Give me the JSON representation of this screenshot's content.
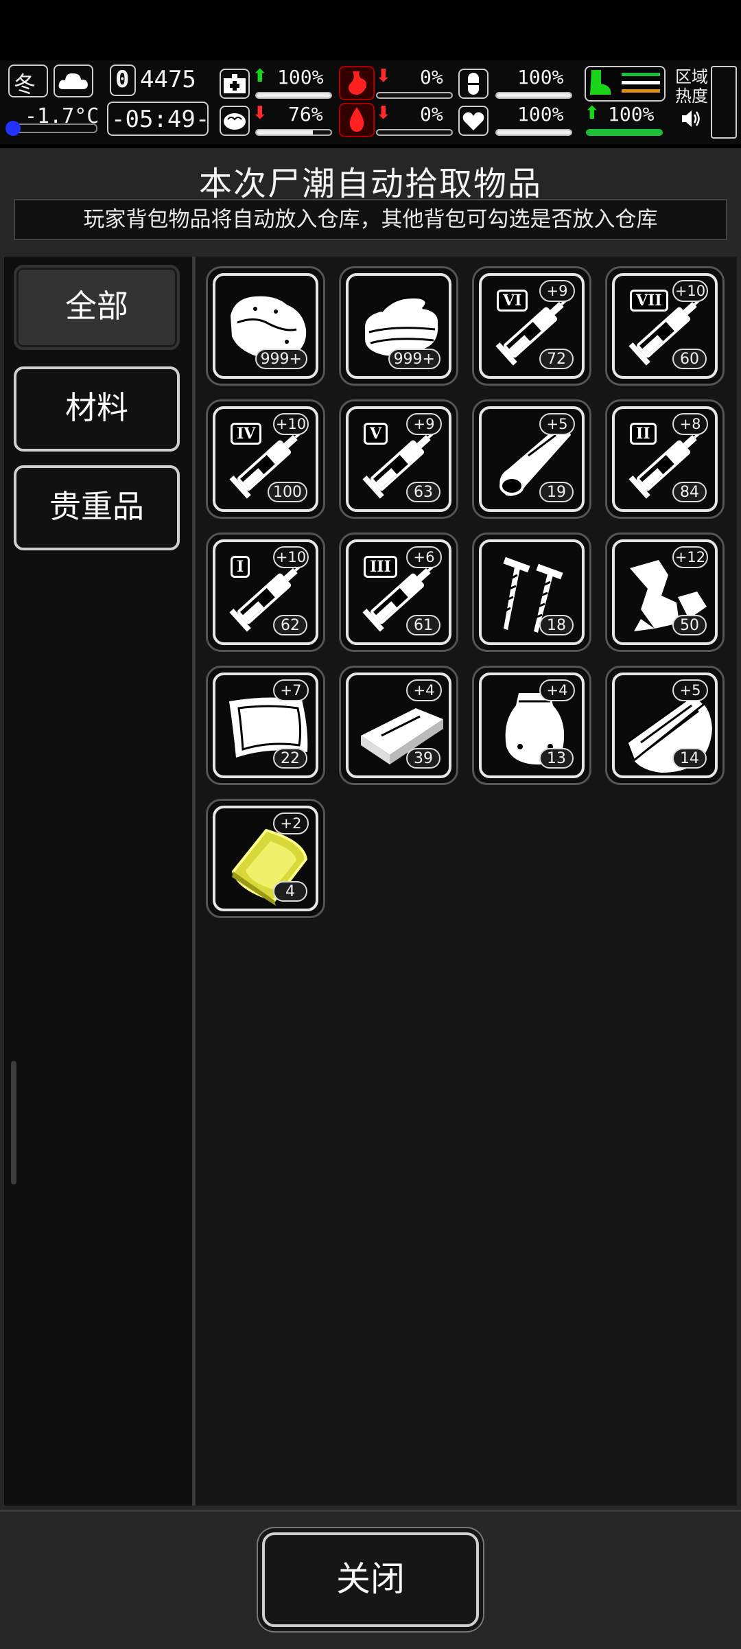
{
  "status": {
    "season": "冬",
    "temperature": "-1.7°C",
    "day_counter": "4475",
    "day_icon": "0",
    "clock": "-05:49-",
    "stats": [
      {
        "icon": "medkit-icon",
        "trend": "up",
        "value": "100%",
        "fill": 1.0
      },
      {
        "icon": "stomach-icon",
        "trend": "down",
        "value": "0%",
        "fill": 0.0
      },
      {
        "icon": "pill-icon",
        "trend": "none",
        "value": "100%",
        "fill": 1.0
      },
      {
        "icon": "brain-icon",
        "trend": "down",
        "value": "76%",
        "fill": 0.76
      },
      {
        "icon": "blood-drop-icon",
        "trend": "down",
        "value": "0%",
        "fill": 0.0
      },
      {
        "icon": "heart-icon",
        "trend": "none",
        "value": "100%",
        "fill": 1.0
      }
    ],
    "stamina": {
      "trend": "up",
      "value": "100%",
      "fill": 1.0
    },
    "zone_heat_label": "区域\n热度",
    "colors": {
      "up": "#19d419",
      "down": "#ff2a2a",
      "green": "#1fbf3a",
      "orange": "#e08a1e"
    }
  },
  "panel": {
    "title": "本次尸潮自动拾取物品",
    "subtitle": "玩家背包物品将自动放入仓库，其他背包可勾选是否放入仓库"
  },
  "sidebar": {
    "tabs": [
      {
        "label": "全部",
        "active": true
      },
      {
        "label": "材料",
        "active": false
      },
      {
        "label": "贵重品",
        "active": false
      }
    ]
  },
  "items": [
    {
      "icon": "raw-meat-icon",
      "count": "999+",
      "bonus": null,
      "tier": null
    },
    {
      "icon": "cloth-icon",
      "count": "999+",
      "bonus": null,
      "tier": null
    },
    {
      "icon": "syringe-icon",
      "count": "72",
      "bonus": "+9",
      "tier": "VI"
    },
    {
      "icon": "syringe-icon",
      "count": "60",
      "bonus": "+10",
      "tier": "VII"
    },
    {
      "icon": "syringe-icon",
      "count": "100",
      "bonus": "+10",
      "tier": "IV"
    },
    {
      "icon": "syringe-icon",
      "count": "63",
      "bonus": "+9",
      "tier": "V"
    },
    {
      "icon": "leather-roll-icon",
      "count": "19",
      "bonus": "+5",
      "tier": null
    },
    {
      "icon": "syringe-icon",
      "count": "84",
      "bonus": "+8",
      "tier": "II"
    },
    {
      "icon": "syringe-icon",
      "count": "62",
      "bonus": "+10",
      "tier": "I"
    },
    {
      "icon": "syringe-icon",
      "count": "61",
      "bonus": "+6",
      "tier": "III"
    },
    {
      "icon": "screws-icon",
      "count": "18",
      "bonus": null,
      "tier": null
    },
    {
      "icon": "scrap-metal-icon",
      "count": "50",
      "bonus": "+12",
      "tier": null
    },
    {
      "icon": "fabric-sheet-icon",
      "count": "22",
      "bonus": "+7",
      "tier": null
    },
    {
      "icon": "wood-plank-icon",
      "count": "39",
      "bonus": "+4",
      "tier": null
    },
    {
      "icon": "plastic-bag-icon",
      "count": "13",
      "bonus": "+4",
      "tier": null
    },
    {
      "icon": "wood-log-icon",
      "count": "14",
      "bonus": "+5",
      "tier": null
    },
    {
      "icon": "gold-bar-icon",
      "count": "4",
      "bonus": "+2",
      "tier": null
    }
  ],
  "footer": {
    "close_label": "关闭"
  }
}
